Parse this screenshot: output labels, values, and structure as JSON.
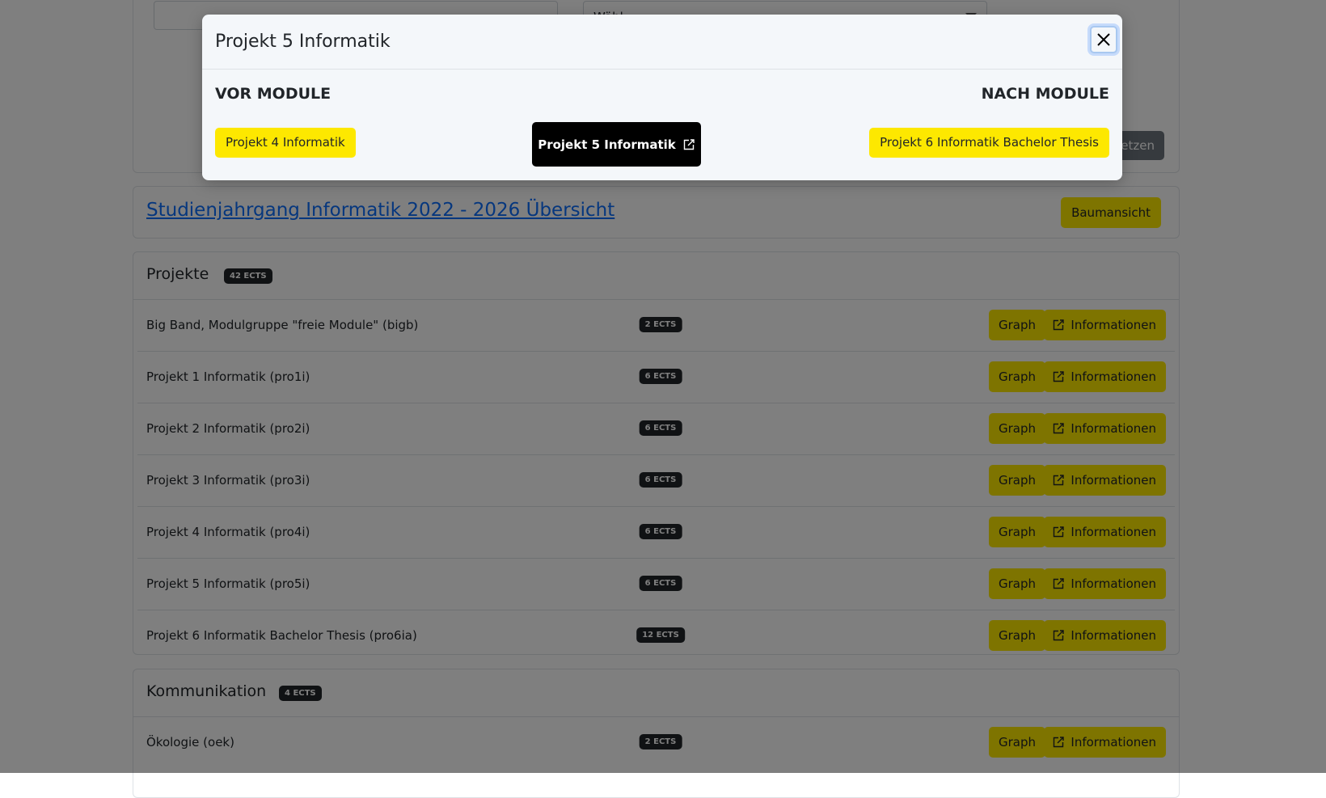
{
  "top_filter": {
    "select_value": "Wähl",
    "reset_label": "Zurücksetzen"
  },
  "overview": {
    "link_text": "Studienjahrgang Informatik 2022 - 2026 Übersicht",
    "tree_button": "Baumansicht"
  },
  "sections": [
    {
      "title": "Projekte",
      "ects": "42 ECTS",
      "rows": [
        {
          "name": "Big Band, Modulgruppe \"freie Module\" (bigb)",
          "ects": "2 ECTS"
        },
        {
          "name": "Projekt 1 Informatik (pro1i)",
          "ects": "6 ECTS"
        },
        {
          "name": "Projekt 2 Informatik (pro2i)",
          "ects": "6 ECTS"
        },
        {
          "name": "Projekt 3 Informatik (pro3i)",
          "ects": "6 ECTS"
        },
        {
          "name": "Projekt 4 Informatik (pro4i)",
          "ects": "6 ECTS"
        },
        {
          "name": "Projekt 5 Informatik (pro5i)",
          "ects": "6 ECTS"
        },
        {
          "name": "Projekt 6 Informatik Bachelor Thesis (pro6ia)",
          "ects": "12 ECTS"
        }
      ]
    },
    {
      "title": "Kommunikation",
      "ects": "4 ECTS",
      "rows": [
        {
          "name": "Ökologie (oek)",
          "ects": "2 ECTS"
        }
      ]
    }
  ],
  "row_buttons": {
    "graph": "Graph",
    "info": "Informationen"
  },
  "modal": {
    "title": "Projekt 5 Informatik",
    "vor_label": "VOR MODULE",
    "nach_label": "NACH MODULE",
    "vor_module": "Projekt 4 Informatik",
    "current_module": "Projekt 5 Informatik",
    "nach_module": "Projekt 6 Informatik Bachelor Thesis"
  },
  "colors": {
    "accent_yellow": "#fde800",
    "link_blue": "#0d6efd",
    "badge_dark": "#212529"
  }
}
